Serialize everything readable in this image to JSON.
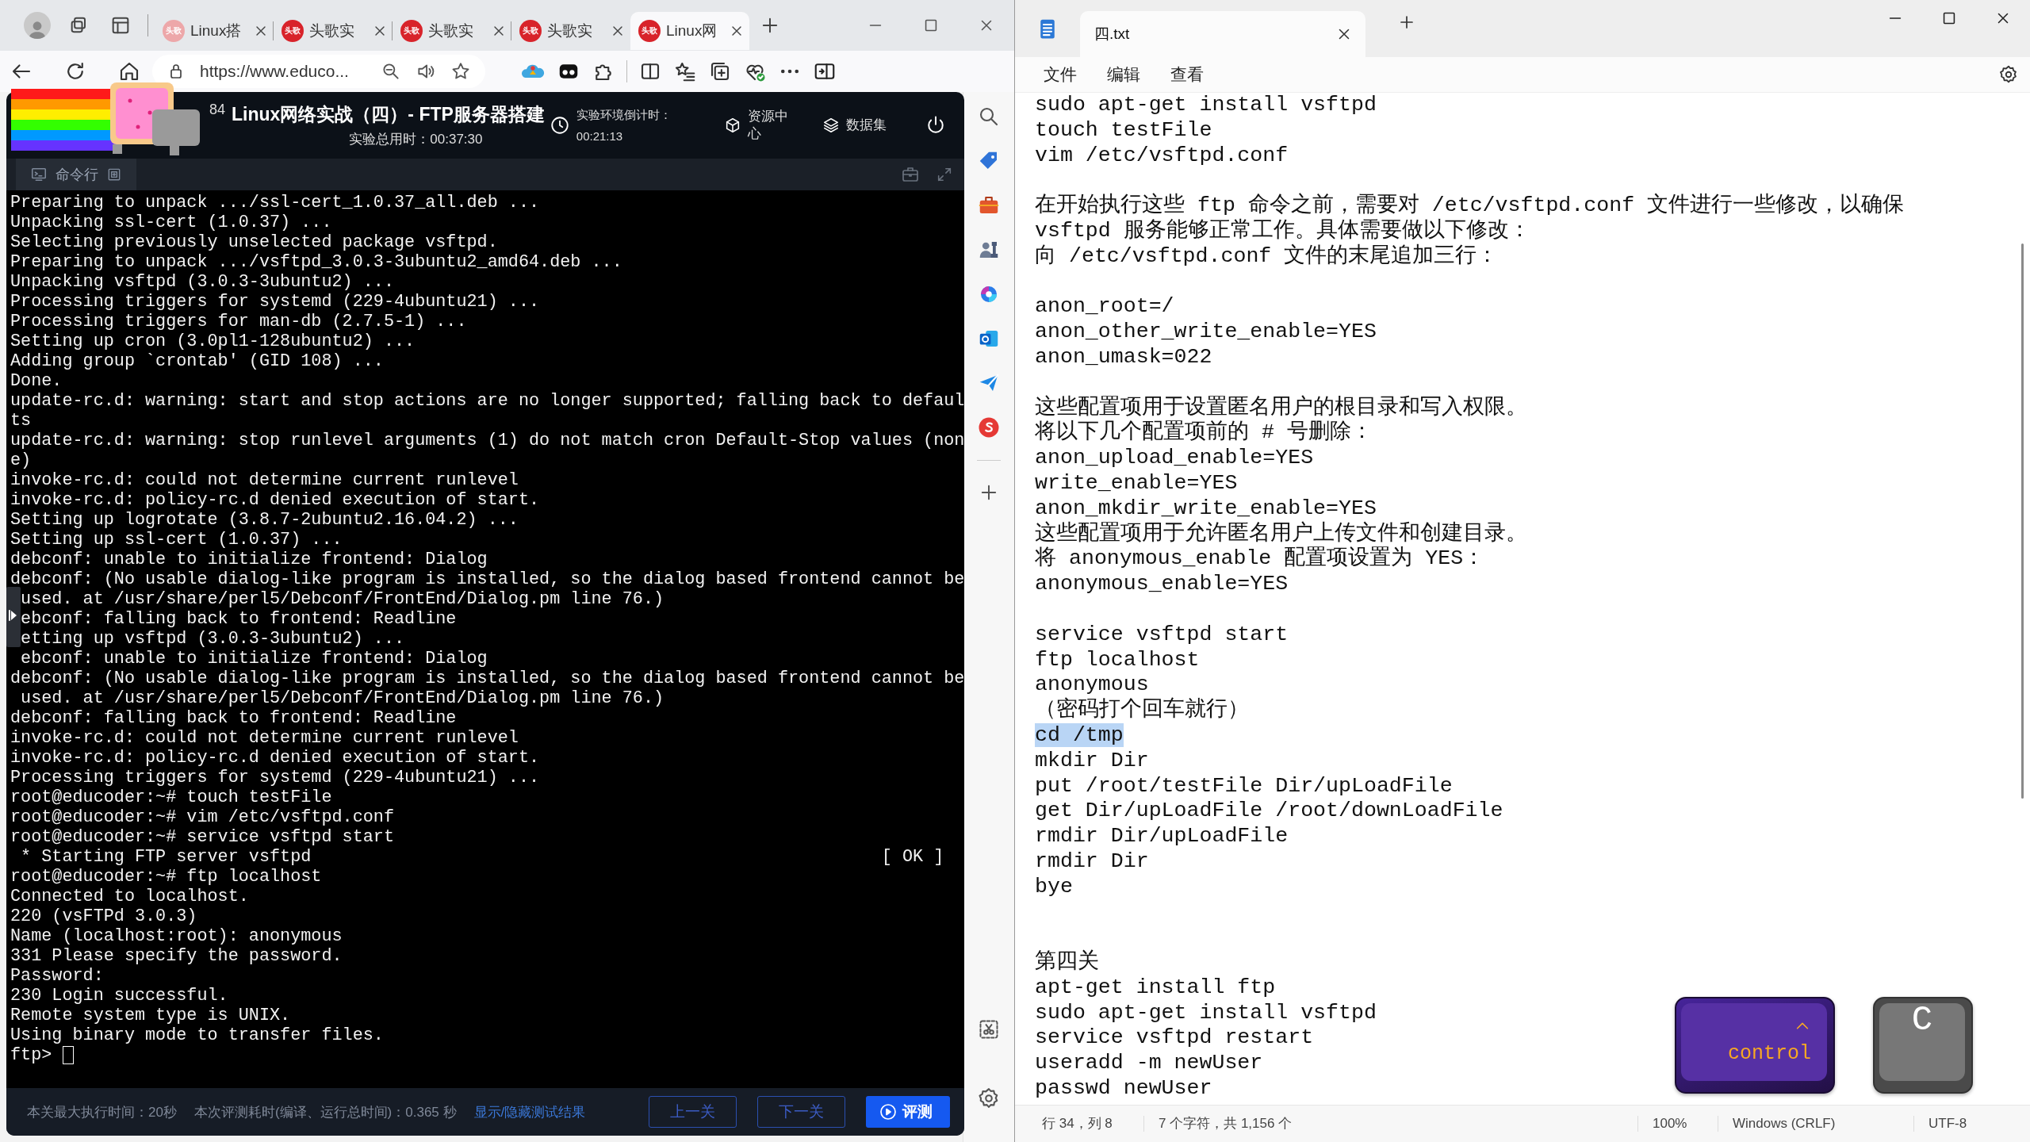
{
  "browser": {
    "tabs": [
      {
        "favicon": "头歌",
        "title": "Linux搭",
        "sleeping": true,
        "selected": false
      },
      {
        "favicon": "头歌",
        "title": "头歌实",
        "sleeping": false,
        "selected": false
      },
      {
        "favicon": "头歌",
        "title": "头歌实",
        "sleeping": false,
        "selected": false
      },
      {
        "favicon": "头歌",
        "title": "头歌实",
        "sleeping": false,
        "selected": false
      },
      {
        "favicon": "头歌",
        "title": "Linux网",
        "sleeping": false,
        "selected": true
      }
    ],
    "address": "https://www.educo..."
  },
  "lab": {
    "badge": "84",
    "title": "Linux网络实战（四）- FTP服务器搭建",
    "elapsed": "实验总用时：00:37:30",
    "countdown_label": "实验环境倒计时：",
    "countdown": "00:21:13",
    "links": [
      {
        "kind": "resources",
        "label": "资源中心"
      },
      {
        "kind": "datasets",
        "label": "数据集"
      }
    ],
    "panel_tab": "命令行",
    "terminal": [
      "Preparing to unpack .../ssl-cert_1.0.37_all.deb ...",
      "Unpacking ssl-cert (1.0.37) ...",
      "Selecting previously unselected package vsftpd.",
      "Preparing to unpack .../vsftpd_3.0.3-3ubuntu2_amd64.deb ...",
      "Unpacking vsftpd (3.0.3-3ubuntu2) ...",
      "Processing triggers for systemd (229-4ubuntu21) ...",
      "Processing triggers for man-db (2.7.5-1) ...",
      "Setting up cron (3.0pl1-128ubuntu2) ...",
      "Adding group `crontab' (GID 108) ...",
      "Done.",
      "update-rc.d: warning: start and stop actions are no longer supported; falling back to defaul",
      "ts",
      "update-rc.d: warning: stop runlevel arguments (1) do not match cron Default-Stop values (non",
      "e)",
      "invoke-rc.d: could not determine current runlevel",
      "invoke-rc.d: policy-rc.d denied execution of start.",
      "Setting up logrotate (3.8.7-2ubuntu2.16.04.2) ...",
      "Setting up ssl-cert (1.0.37) ...",
      "debconf: unable to initialize frontend: Dialog",
      "debconf: (No usable dialog-like program is installed, so the dialog based frontend cannot be",
      " used. at /usr/share/perl5/Debconf/FrontEnd/Dialog.pm line 76.)",
      " ebconf: falling back to frontend: Readline",
      " etting up vsftpd (3.0.3-3ubuntu2) ...",
      " ebconf: unable to initialize frontend: Dialog",
      "debconf: (No usable dialog-like program is installed, so the dialog based frontend cannot be",
      " used. at /usr/share/perl5/Debconf/FrontEnd/Dialog.pm line 76.)",
      "debconf: falling back to frontend: Readline",
      "invoke-rc.d: could not determine current runlevel",
      "invoke-rc.d: policy-rc.d denied execution of start.",
      "Processing triggers for systemd (229-4ubuntu21) ...",
      "root@educoder:~# touch testFile",
      "root@educoder:~# vim /etc/vsftpd.conf",
      "root@educoder:~# service vsftpd start",
      " * Starting FTP server vsftpd                                                       [ OK ]",
      "root@educoder:~# ftp localhost",
      "Connected to localhost.",
      "220 (vsFTPd 3.0.3)",
      "Name (localhost:root): anonymous",
      "331 Please specify the password.",
      "Password:",
      "230 Login successful.",
      "Remote system type is UNIX.",
      "Using binary mode to transfer files.",
      "ftp>"
    ],
    "footer": {
      "max_time": "本关最大执行时间：20秒",
      "elapsed": "本次评测耗时(编译、运行总时间)：0.365 秒",
      "toggle_link": "显示/隐藏测试结果",
      "buttons": [
        {
          "kind": "secondary",
          "label": "上一关"
        },
        {
          "kind": "secondary",
          "label": "下一关"
        },
        {
          "kind": "primary",
          "label": "评测"
        }
      ]
    }
  },
  "notepad": {
    "tab_title": "四.txt",
    "menu": [
      "文件",
      "编辑",
      "查看"
    ],
    "lines": [
      {
        "kind": "text",
        "text": "sudo apt-get install vsftpd"
      },
      {
        "kind": "text",
        "text": "touch testFile"
      },
      {
        "kind": "text",
        "text": "vim /etc/vsftpd.conf"
      },
      {
        "kind": "blank"
      },
      {
        "kind": "text",
        "text": "在开始执行这些 ftp 命令之前，需要对 /etc/vsftpd.conf 文件进行一些修改，以确保"
      },
      {
        "kind": "text",
        "text": "vsftpd 服务能够正常工作。具体需要做以下修改："
      },
      {
        "kind": "text",
        "text": "向 /etc/vsftpd.conf 文件的末尾追加三行："
      },
      {
        "kind": "blank"
      },
      {
        "kind": "text",
        "text": "anon_root=/"
      },
      {
        "kind": "text",
        "text": "anon_other_write_enable=YES"
      },
      {
        "kind": "text",
        "text": "anon_umask=022"
      },
      {
        "kind": "blank"
      },
      {
        "kind": "text",
        "text": "这些配置项用于设置匿名用户的根目录和写入权限。"
      },
      {
        "kind": "text",
        "text": "将以下几个配置项前的 # 号删除："
      },
      {
        "kind": "text",
        "text": "anon_upload_enable=YES"
      },
      {
        "kind": "text",
        "text": "write_enable=YES"
      },
      {
        "kind": "text",
        "text": "anon_mkdir_write_enable=YES"
      },
      {
        "kind": "text",
        "text": "这些配置项用于允许匿名用户上传文件和创建目录。"
      },
      {
        "kind": "text",
        "text": "将 anonymous_enable 配置项设置为 YES："
      },
      {
        "kind": "text",
        "text": "anonymous_enable=YES"
      },
      {
        "kind": "blank"
      },
      {
        "kind": "text",
        "text": "service vsftpd start"
      },
      {
        "kind": "text",
        "text": "ftp localhost"
      },
      {
        "kind": "text",
        "text": "anonymous"
      },
      {
        "kind": "text",
        "text": "（密码打个回车就行）"
      },
      {
        "kind": "selection",
        "text": "cd /tmp"
      },
      {
        "kind": "text",
        "text": "mkdir Dir"
      },
      {
        "kind": "text",
        "text": "put /root/testFile Dir/upLoadFile"
      },
      {
        "kind": "text",
        "text": "get Dir/upLoadFile /root/downLoadFile"
      },
      {
        "kind": "text",
        "text": "rmdir Dir/upLoadFile"
      },
      {
        "kind": "text",
        "text": "rmdir Dir"
      },
      {
        "kind": "text",
        "text": "bye"
      },
      {
        "kind": "blank"
      },
      {
        "kind": "blank"
      },
      {
        "kind": "text",
        "text": "第四关"
      },
      {
        "kind": "text",
        "text": "apt-get install ftp"
      },
      {
        "kind": "text",
        "text": "sudo apt-get install vsftpd"
      },
      {
        "kind": "text",
        "text": "service vsftpd restart"
      },
      {
        "kind": "text",
        "text": "useradd -m newUser"
      },
      {
        "kind": "text",
        "text": "passwd newUser"
      }
    ],
    "status": [
      "行 34，列 8",
      "7 个字符，共 1,156 个",
      "100%",
      "Windows (CRLF)",
      "UTF-8"
    ]
  },
  "key_overlay": [
    {
      "kind": "modifier",
      "label": "control"
    },
    {
      "kind": "letter",
      "label": "C"
    }
  ]
}
